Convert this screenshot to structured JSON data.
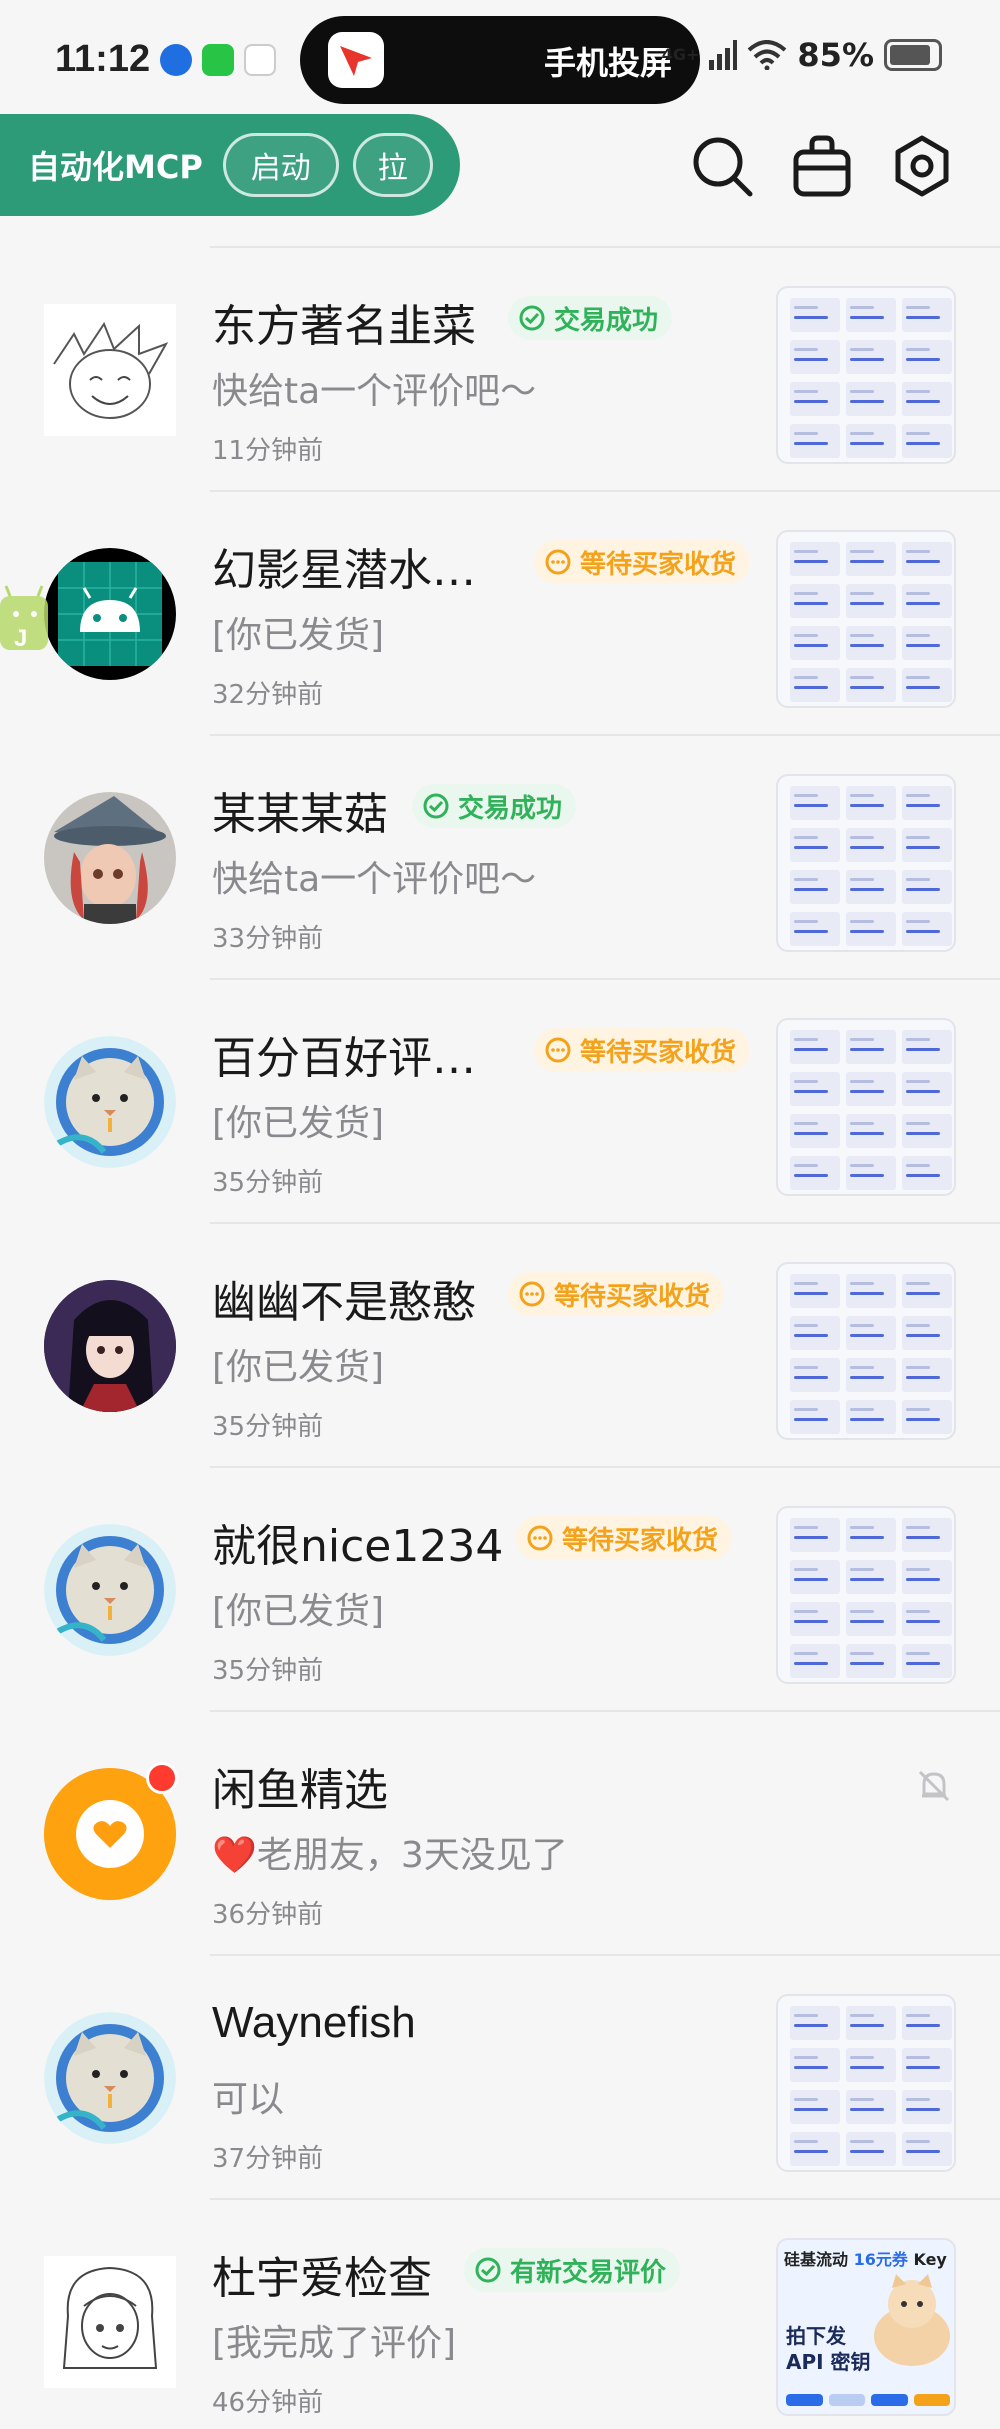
{
  "status_bar": {
    "time": "11:12",
    "island_text": "手机投屏",
    "network": "4G+",
    "battery": "85%"
  },
  "toolbar": {
    "title": "自动化MCP",
    "start_label": "启动",
    "pull_label": "拉",
    "icons": [
      "search-icon",
      "bag-icon",
      "settings-icon"
    ]
  },
  "conversations": [
    {
      "name": "东方著名韭菜",
      "badge": "交易成功",
      "badge_type": "success",
      "message": "快给ta一个评价吧～",
      "time": "11分钟前"
    },
    {
      "name": "幻影星潜水…",
      "badge": "等待买家收货",
      "badge_type": "pending",
      "message": "[你已发货]",
      "time": "32分钟前"
    },
    {
      "name": "某某某菇",
      "badge": "交易成功",
      "badge_type": "success",
      "message": "快给ta一个评价吧～",
      "time": "33分钟前"
    },
    {
      "name": "百分百好评…",
      "badge": "等待买家收货",
      "badge_type": "pending",
      "message": "[你已发货]",
      "time": "35分钟前"
    },
    {
      "name": "幽幽不是憨憨",
      "badge": "等待买家收货",
      "badge_type": "pending",
      "message": "[你已发货]",
      "time": "35分钟前"
    },
    {
      "name": "就很nice1234",
      "badge": "等待买家收货",
      "badge_type": "pending",
      "message": "[你已发货]",
      "time": "35分钟前"
    },
    {
      "name": "闲鱼精选",
      "badge": "",
      "badge_type": "none",
      "message": "❤️老朋友，3天没见了",
      "time": "36分钟前",
      "muted": true
    },
    {
      "name": "Waynefish",
      "badge": "",
      "badge_type": "none",
      "message": "可以",
      "time": "37分钟前"
    },
    {
      "name": "杜宇爱检查",
      "badge": "有新交易评价",
      "badge_type": "success",
      "message": "[我完成了评价]",
      "time": "46分钟前"
    }
  ],
  "last_thumb": {
    "line1": "硅基流动",
    "line1_amount": "16元券",
    "line1_suffix": "Key",
    "line2": "拍下发",
    "line3": "API 密钥"
  },
  "colors": {
    "accent": "#2e9b78",
    "success": "#30b25a",
    "pending": "#f5a21b"
  }
}
